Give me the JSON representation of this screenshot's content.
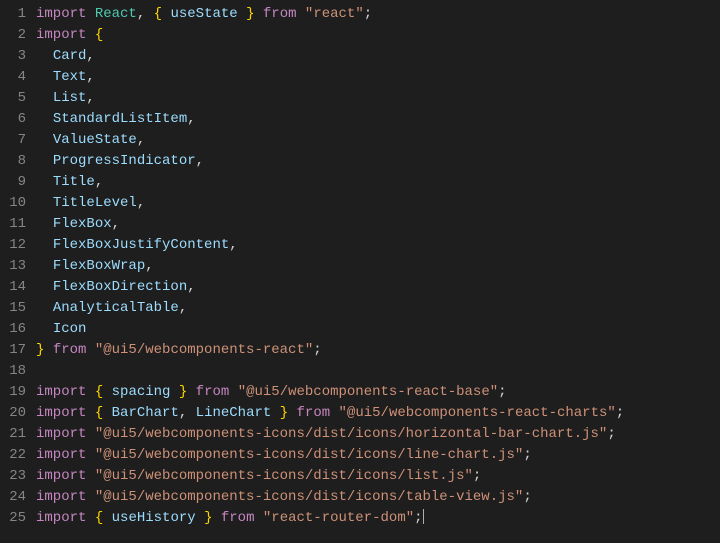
{
  "lines": [
    {
      "n": 1,
      "tokens": [
        {
          "c": "k",
          "t": "import"
        },
        {
          "c": "p",
          "t": " "
        },
        {
          "c": "mod",
          "t": "React"
        },
        {
          "c": "p",
          "t": ", "
        },
        {
          "c": "brace",
          "t": "{"
        },
        {
          "c": "p",
          "t": " "
        },
        {
          "c": "id",
          "t": "useState"
        },
        {
          "c": "p",
          "t": " "
        },
        {
          "c": "brace",
          "t": "}"
        },
        {
          "c": "p",
          "t": " "
        },
        {
          "c": "k",
          "t": "from"
        },
        {
          "c": "p",
          "t": " "
        },
        {
          "c": "s",
          "t": "\"react\""
        },
        {
          "c": "p",
          "t": ";"
        }
      ]
    },
    {
      "n": 2,
      "tokens": [
        {
          "c": "k",
          "t": "import"
        },
        {
          "c": "p",
          "t": " "
        },
        {
          "c": "brace",
          "t": "{"
        }
      ]
    },
    {
      "n": 3,
      "tokens": [
        {
          "c": "p",
          "t": "  "
        },
        {
          "c": "id",
          "t": "Card"
        },
        {
          "c": "p",
          "t": ","
        }
      ]
    },
    {
      "n": 4,
      "tokens": [
        {
          "c": "p",
          "t": "  "
        },
        {
          "c": "id",
          "t": "Text"
        },
        {
          "c": "p",
          "t": ","
        }
      ]
    },
    {
      "n": 5,
      "tokens": [
        {
          "c": "p",
          "t": "  "
        },
        {
          "c": "id",
          "t": "List"
        },
        {
          "c": "p",
          "t": ","
        }
      ]
    },
    {
      "n": 6,
      "tokens": [
        {
          "c": "p",
          "t": "  "
        },
        {
          "c": "id",
          "t": "StandardListItem"
        },
        {
          "c": "p",
          "t": ","
        }
      ]
    },
    {
      "n": 7,
      "tokens": [
        {
          "c": "p",
          "t": "  "
        },
        {
          "c": "id",
          "t": "ValueState"
        },
        {
          "c": "p",
          "t": ","
        }
      ]
    },
    {
      "n": 8,
      "tokens": [
        {
          "c": "p",
          "t": "  "
        },
        {
          "c": "id",
          "t": "ProgressIndicator"
        },
        {
          "c": "p",
          "t": ","
        }
      ]
    },
    {
      "n": 9,
      "tokens": [
        {
          "c": "p",
          "t": "  "
        },
        {
          "c": "id",
          "t": "Title"
        },
        {
          "c": "p",
          "t": ","
        }
      ]
    },
    {
      "n": 10,
      "tokens": [
        {
          "c": "p",
          "t": "  "
        },
        {
          "c": "id",
          "t": "TitleLevel"
        },
        {
          "c": "p",
          "t": ","
        }
      ]
    },
    {
      "n": 11,
      "tokens": [
        {
          "c": "p",
          "t": "  "
        },
        {
          "c": "id",
          "t": "FlexBox"
        },
        {
          "c": "p",
          "t": ","
        }
      ]
    },
    {
      "n": 12,
      "tokens": [
        {
          "c": "p",
          "t": "  "
        },
        {
          "c": "id",
          "t": "FlexBoxJustifyContent"
        },
        {
          "c": "p",
          "t": ","
        }
      ]
    },
    {
      "n": 13,
      "tokens": [
        {
          "c": "p",
          "t": "  "
        },
        {
          "c": "id",
          "t": "FlexBoxWrap"
        },
        {
          "c": "p",
          "t": ","
        }
      ]
    },
    {
      "n": 14,
      "tokens": [
        {
          "c": "p",
          "t": "  "
        },
        {
          "c": "id",
          "t": "FlexBoxDirection"
        },
        {
          "c": "p",
          "t": ","
        }
      ]
    },
    {
      "n": 15,
      "tokens": [
        {
          "c": "p",
          "t": "  "
        },
        {
          "c": "id",
          "t": "AnalyticalTable"
        },
        {
          "c": "p",
          "t": ","
        }
      ]
    },
    {
      "n": 16,
      "tokens": [
        {
          "c": "p",
          "t": "  "
        },
        {
          "c": "id",
          "t": "Icon"
        }
      ]
    },
    {
      "n": 17,
      "tokens": [
        {
          "c": "brace",
          "t": "}"
        },
        {
          "c": "p",
          "t": " "
        },
        {
          "c": "k",
          "t": "from"
        },
        {
          "c": "p",
          "t": " "
        },
        {
          "c": "s",
          "t": "\"@ui5/webcomponents-react\""
        },
        {
          "c": "p",
          "t": ";"
        }
      ]
    },
    {
      "n": 18,
      "tokens": []
    },
    {
      "n": 19,
      "tokens": [
        {
          "c": "k",
          "t": "import"
        },
        {
          "c": "p",
          "t": " "
        },
        {
          "c": "brace",
          "t": "{"
        },
        {
          "c": "p",
          "t": " "
        },
        {
          "c": "id",
          "t": "spacing"
        },
        {
          "c": "p",
          "t": " "
        },
        {
          "c": "brace",
          "t": "}"
        },
        {
          "c": "p",
          "t": " "
        },
        {
          "c": "k",
          "t": "from"
        },
        {
          "c": "p",
          "t": " "
        },
        {
          "c": "s",
          "t": "\"@ui5/webcomponents-react-base\""
        },
        {
          "c": "p",
          "t": ";"
        }
      ]
    },
    {
      "n": 20,
      "tokens": [
        {
          "c": "k",
          "t": "import"
        },
        {
          "c": "p",
          "t": " "
        },
        {
          "c": "brace",
          "t": "{"
        },
        {
          "c": "p",
          "t": " "
        },
        {
          "c": "id",
          "t": "BarChart"
        },
        {
          "c": "p",
          "t": ", "
        },
        {
          "c": "id",
          "t": "LineChart"
        },
        {
          "c": "p",
          "t": " "
        },
        {
          "c": "brace",
          "t": "}"
        },
        {
          "c": "p",
          "t": " "
        },
        {
          "c": "k",
          "t": "from"
        },
        {
          "c": "p",
          "t": " "
        },
        {
          "c": "s",
          "t": "\"@ui5/webcomponents-react-charts\""
        },
        {
          "c": "p",
          "t": ";"
        }
      ]
    },
    {
      "n": 21,
      "tokens": [
        {
          "c": "k",
          "t": "import"
        },
        {
          "c": "p",
          "t": " "
        },
        {
          "c": "s",
          "t": "\"@ui5/webcomponents-icons/dist/icons/horizontal-bar-chart.js\""
        },
        {
          "c": "p",
          "t": ";"
        }
      ]
    },
    {
      "n": 22,
      "tokens": [
        {
          "c": "k",
          "t": "import"
        },
        {
          "c": "p",
          "t": " "
        },
        {
          "c": "s",
          "t": "\"@ui5/webcomponents-icons/dist/icons/line-chart.js\""
        },
        {
          "c": "p",
          "t": ";"
        }
      ]
    },
    {
      "n": 23,
      "tokens": [
        {
          "c": "k",
          "t": "import"
        },
        {
          "c": "p",
          "t": " "
        },
        {
          "c": "s",
          "t": "\"@ui5/webcomponents-icons/dist/icons/list.js\""
        },
        {
          "c": "p",
          "t": ";"
        }
      ]
    },
    {
      "n": 24,
      "tokens": [
        {
          "c": "k",
          "t": "import"
        },
        {
          "c": "p",
          "t": " "
        },
        {
          "c": "s",
          "t": "\"@ui5/webcomponents-icons/dist/icons/table-view.js\""
        },
        {
          "c": "p",
          "t": ";"
        }
      ]
    },
    {
      "n": 25,
      "tokens": [
        {
          "c": "k",
          "t": "import"
        },
        {
          "c": "p",
          "t": " "
        },
        {
          "c": "brace",
          "t": "{"
        },
        {
          "c": "p",
          "t": " "
        },
        {
          "c": "id",
          "t": "useHistory"
        },
        {
          "c": "p",
          "t": " "
        },
        {
          "c": "brace",
          "t": "}"
        },
        {
          "c": "p",
          "t": " "
        },
        {
          "c": "k",
          "t": "from"
        },
        {
          "c": "p",
          "t": " "
        },
        {
          "c": "s",
          "t": "\"react-router-dom\""
        },
        {
          "c": "p",
          "t": ";"
        },
        {
          "c": "cursor",
          "t": ""
        }
      ]
    }
  ]
}
